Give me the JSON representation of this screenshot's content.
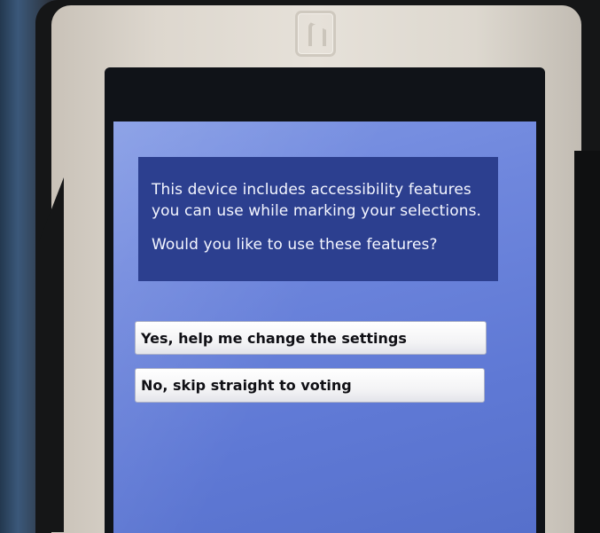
{
  "prompt": {
    "line1": "This device includes accessibility features",
    "line2": "you can use while marking your selections.",
    "question": "Would you like to use these features?"
  },
  "options": [
    {
      "label": "Yes, help me change the settings"
    },
    {
      "label": "No, skip straight to voting"
    }
  ],
  "colors": {
    "screen_background": "#6f87dd",
    "panel_background": "#2c3f8f",
    "button_background": "#f5f5f7",
    "bezel": "#ddd7ce"
  },
  "icons": {
    "device_logo": "h-logo-icon"
  }
}
